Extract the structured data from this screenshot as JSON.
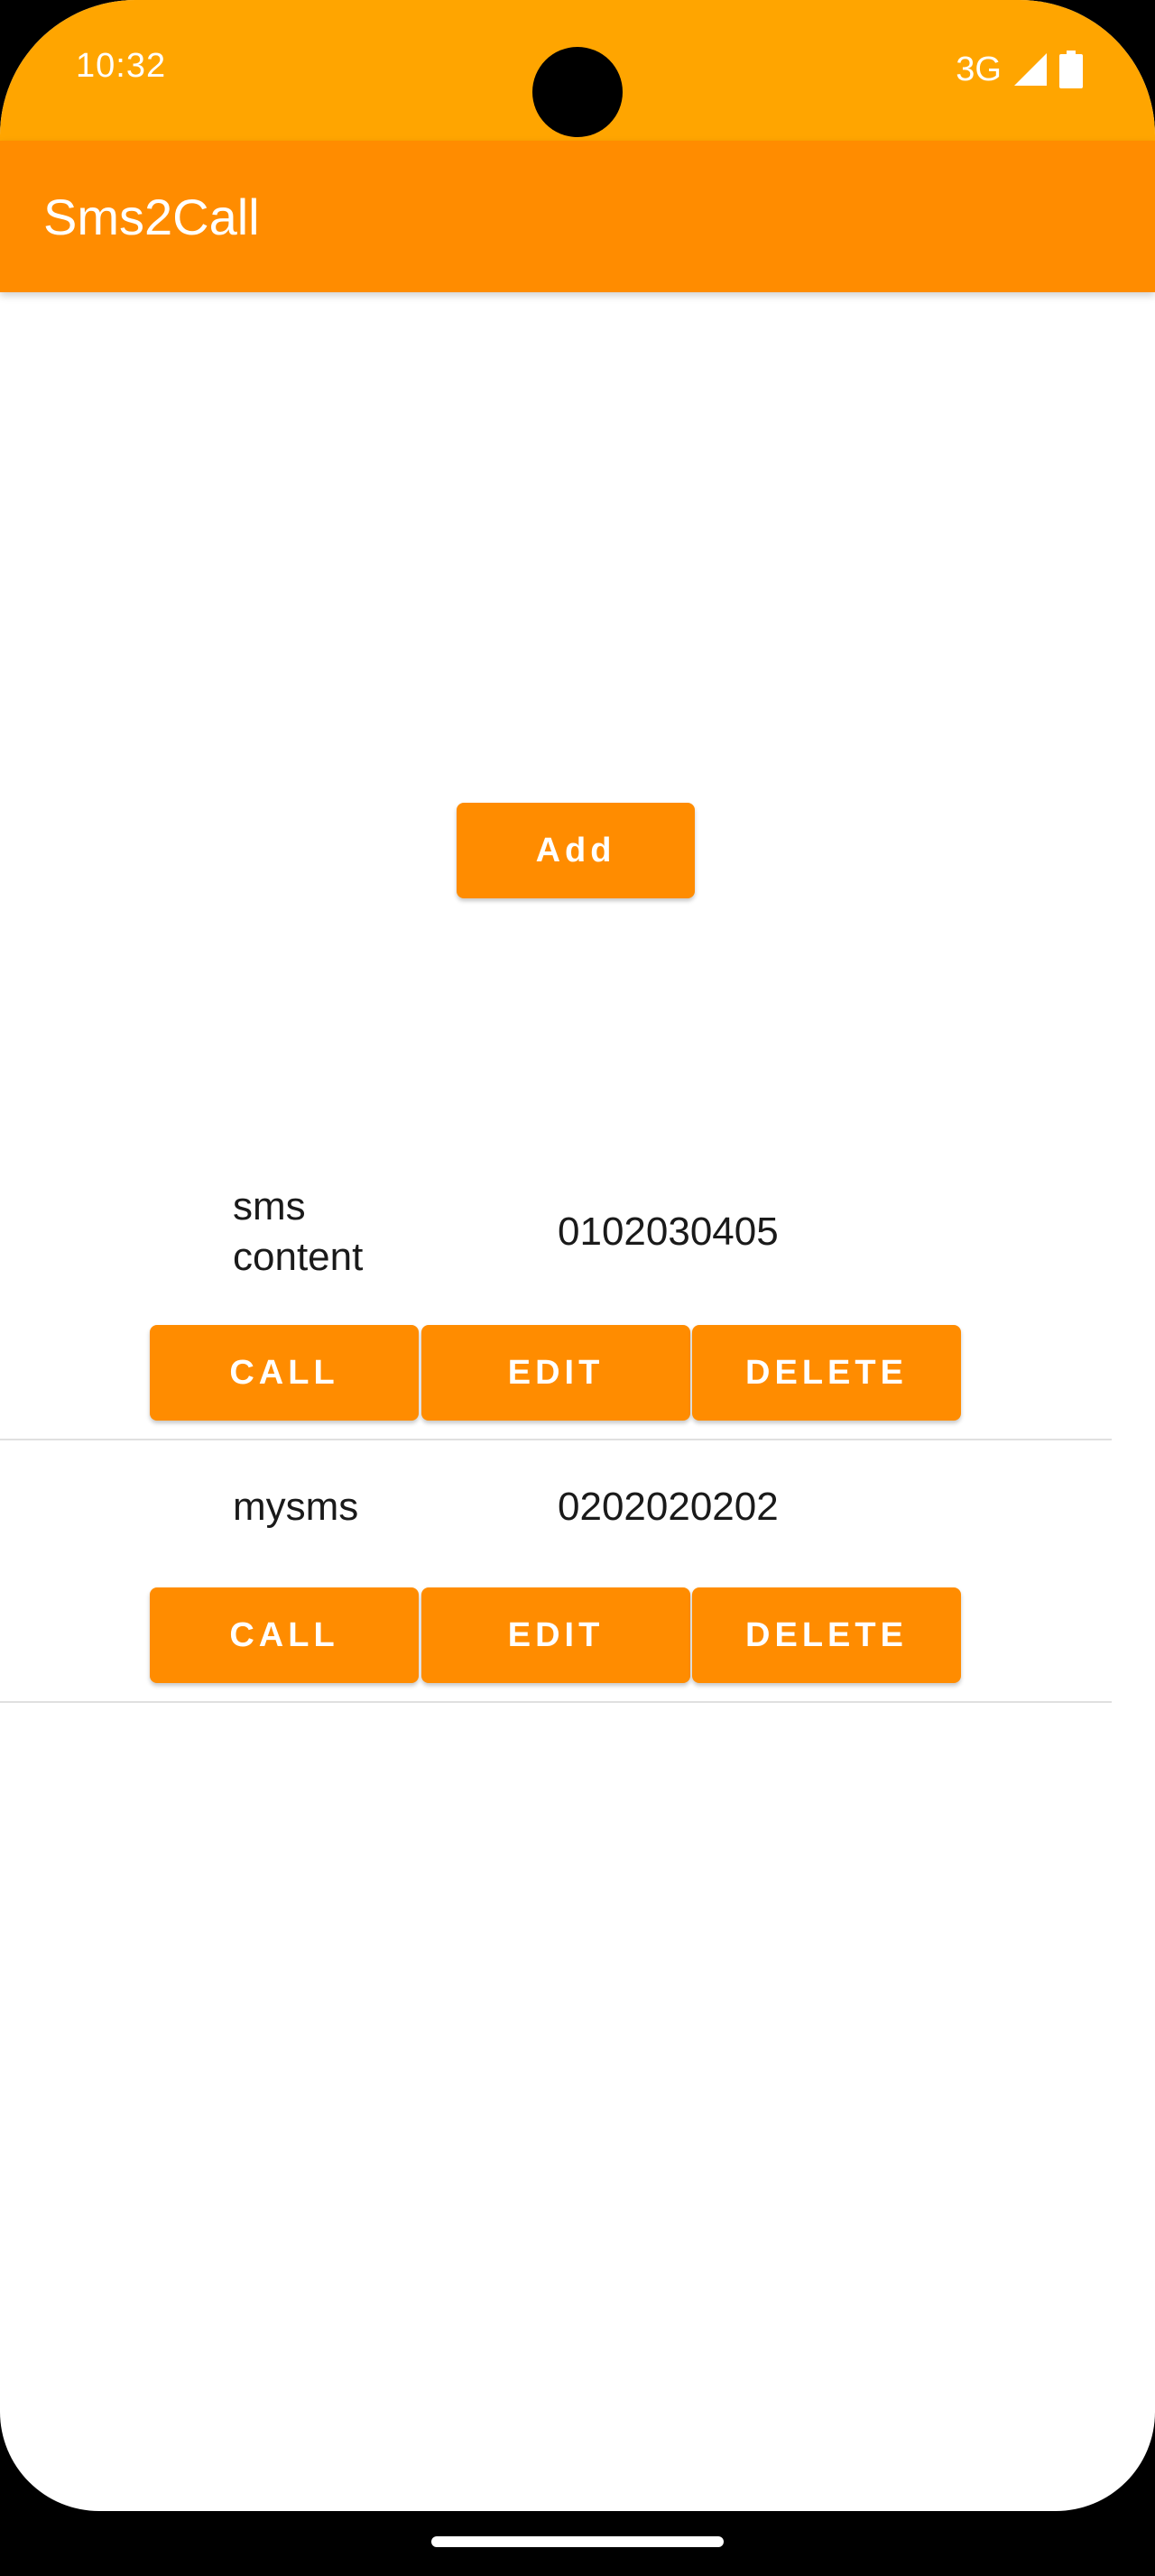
{
  "status_bar": {
    "time": "10:32",
    "network": "3G",
    "icons": [
      "signal-icon",
      "battery-icon"
    ]
  },
  "app_bar": {
    "title": "Sms2Call"
  },
  "add_button_label": "Add",
  "colors": {
    "status_bar": "#FFA500",
    "primary": "#FF8C00",
    "text": "#1a1a1a"
  },
  "rows": [
    {
      "sms": "sms content",
      "number": "0102030405",
      "buttons": {
        "call": "CALL",
        "edit": "EDIT",
        "delete": "DELETE"
      }
    },
    {
      "sms": "mysms",
      "number": "0202020202",
      "buttons": {
        "call": "CALL",
        "edit": "EDIT",
        "delete": "DELETE"
      }
    }
  ]
}
